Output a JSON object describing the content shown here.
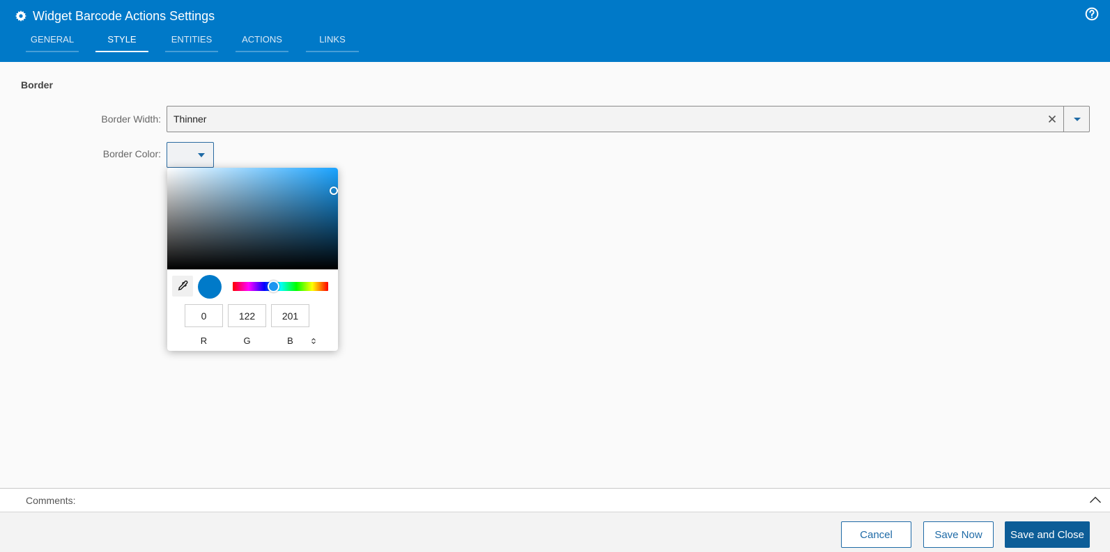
{
  "header": {
    "title": "Widget Barcode Actions Settings",
    "icons": {
      "title": "gear-icon",
      "help": "help-circle-icon"
    },
    "tabs": [
      {
        "label": "GENERAL",
        "active": false
      },
      {
        "label": "STYLE",
        "active": true
      },
      {
        "label": "ENTITIES",
        "active": false
      },
      {
        "label": "ACTIONS",
        "active": false
      },
      {
        "label": "LINKS",
        "active": false
      }
    ]
  },
  "section": {
    "title": "Border",
    "border_width": {
      "label": "Border Width:",
      "value": "Thinner"
    },
    "border_color": {
      "label": "Border Color:"
    }
  },
  "color_picker": {
    "r": "0",
    "g": "122",
    "b": "201",
    "r_label": "R",
    "g_label": "G",
    "b_label": "B",
    "selected_color": "#007ac9"
  },
  "comments": {
    "label": "Comments:"
  },
  "footer": {
    "cancel": "Cancel",
    "save_now": "Save Now",
    "save_close": "Save and Close"
  },
  "colors": {
    "accent": "#0079c8",
    "primary_button": "#0d5d97"
  }
}
